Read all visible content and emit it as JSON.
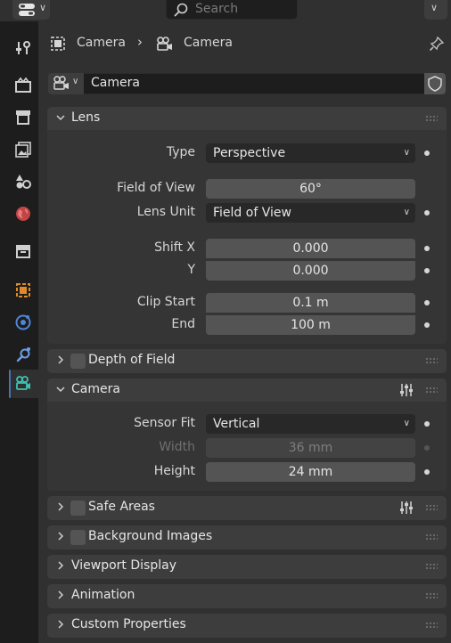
{
  "header": {
    "search_placeholder": "Search"
  },
  "breadcrumb": {
    "object": "Camera",
    "data": "Camera"
  },
  "datablock": {
    "name": "Camera"
  },
  "panels": {
    "lens": {
      "title": "Lens",
      "type_label": "Type",
      "type_value": "Perspective",
      "fov_label": "Field of View",
      "fov_value": "60°",
      "lens_unit_label": "Lens Unit",
      "lens_unit_value": "Field of View",
      "shift_x_label": "Shift X",
      "shift_x_value": "0.000",
      "shift_y_label": "Y",
      "shift_y_value": "0.000",
      "clip_start_label": "Clip Start",
      "clip_start_value": "0.1 m",
      "clip_end_label": "End",
      "clip_end_value": "100 m"
    },
    "dof": {
      "title": "Depth of Field"
    },
    "camera": {
      "title": "Camera",
      "sensor_fit_label": "Sensor Fit",
      "sensor_fit_value": "Vertical",
      "width_label": "Width",
      "width_value": "36 mm",
      "height_label": "Height",
      "height_value": "24 mm"
    },
    "safe_areas": {
      "title": "Safe Areas"
    },
    "background_images": {
      "title": "Background Images"
    },
    "viewport_display": {
      "title": "Viewport Display"
    },
    "animation": {
      "title": "Animation"
    },
    "custom_properties": {
      "title": "Custom Properties"
    }
  },
  "sidebar_tabs": [
    "tool-icon",
    "render-icon",
    "output-icon",
    "view-layer-icon",
    "scene-icon",
    "world-icon",
    "collection-icon",
    "object-icon",
    "physics-icon",
    "constraints-icon",
    "camera-data-icon"
  ],
  "colors": {
    "accent": "#4772b3",
    "active_object": "#e08a2b",
    "data_teal": "#3fc1b0"
  }
}
